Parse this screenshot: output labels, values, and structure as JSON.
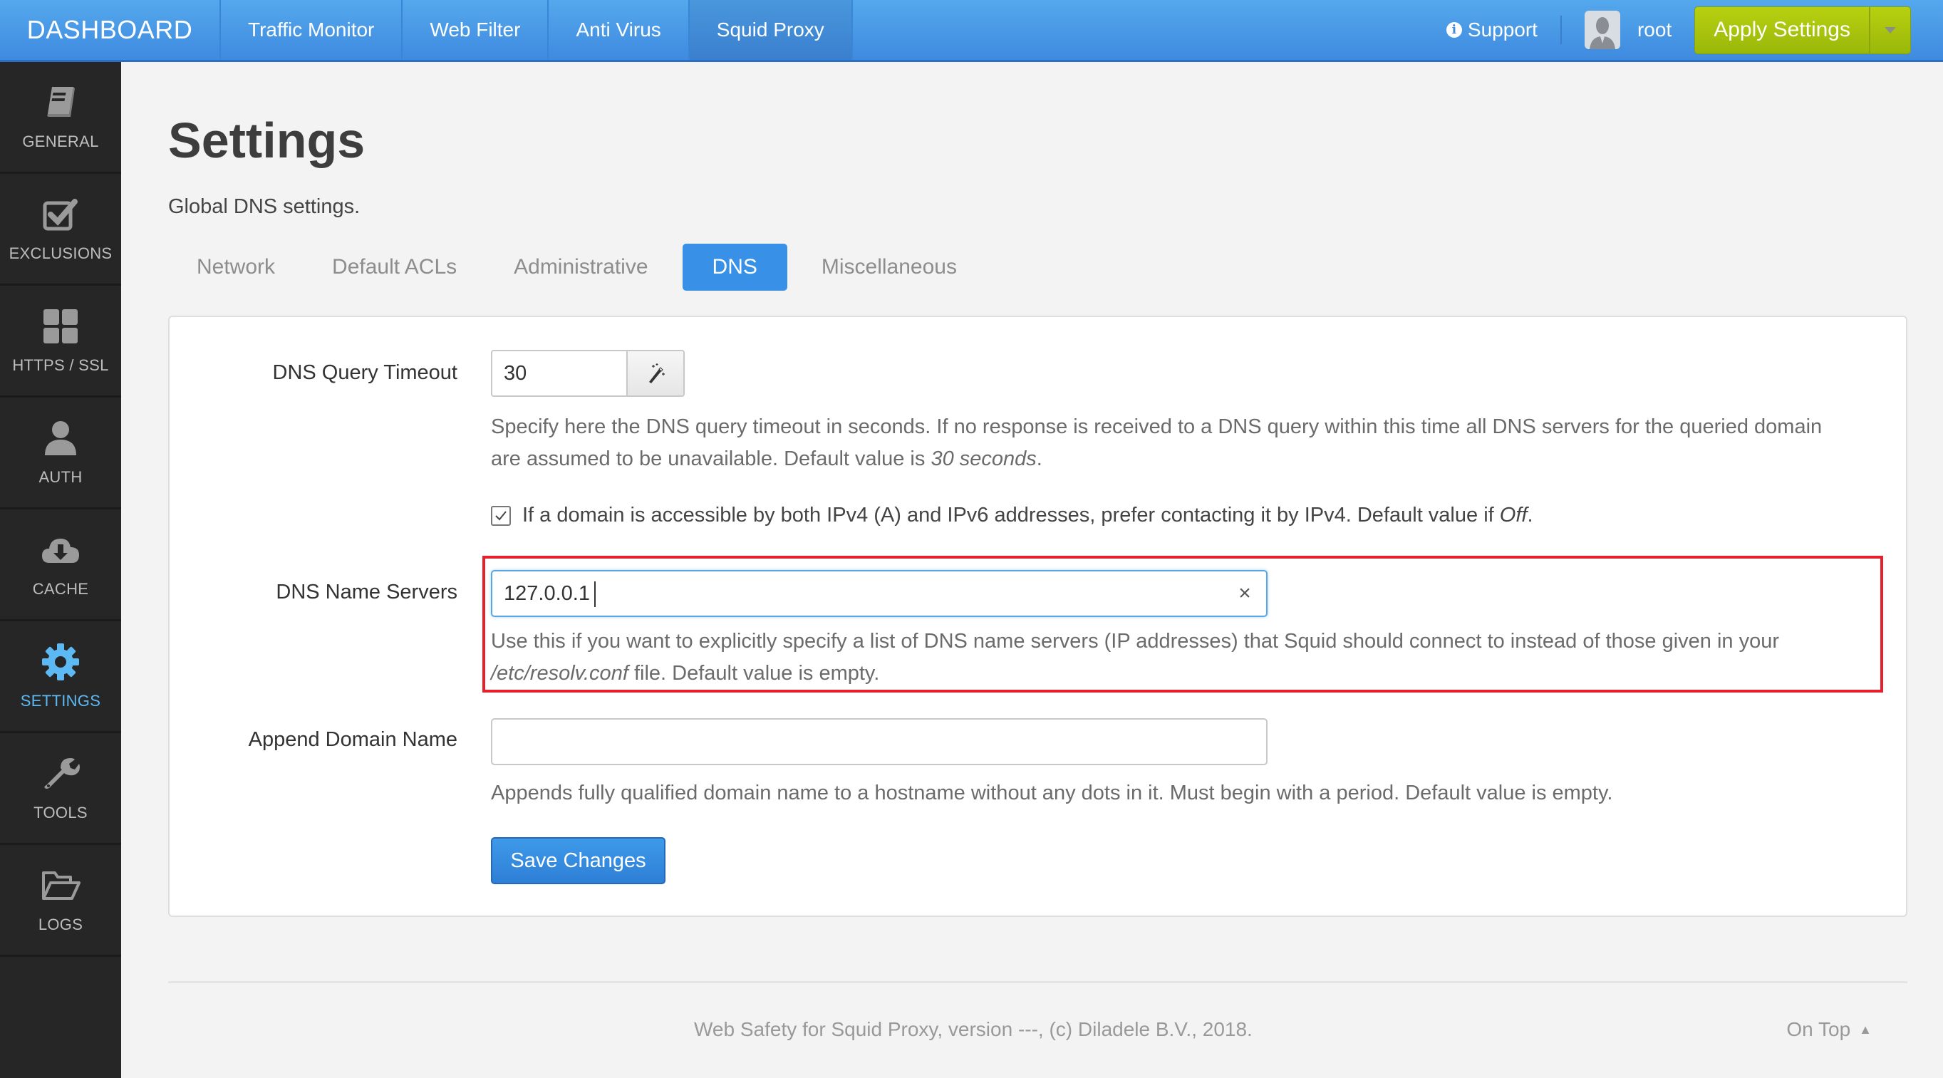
{
  "topbar": {
    "brand": "DASHBOARD",
    "nav": [
      {
        "label": "Traffic Monitor",
        "active": false
      },
      {
        "label": "Web Filter",
        "active": false
      },
      {
        "label": "Anti Virus",
        "active": false
      },
      {
        "label": "Squid Proxy",
        "active": true
      }
    ],
    "support_label": "Support",
    "user_name": "root",
    "apply_label": "Apply Settings",
    "accent_color": "#4a9ae6",
    "apply_color": "#a8c40c"
  },
  "sidebar": {
    "items": [
      {
        "label": "GENERAL",
        "icon": "book-icon",
        "active": false
      },
      {
        "label": "EXCLUSIONS",
        "icon": "checkbox-icon",
        "active": false
      },
      {
        "label": "HTTPS / SSL",
        "icon": "grid-icon",
        "active": false
      },
      {
        "label": "AUTH",
        "icon": "user-icon",
        "active": false
      },
      {
        "label": "CACHE",
        "icon": "cloud-download-icon",
        "active": false
      },
      {
        "label": "SETTINGS",
        "icon": "gear-icon",
        "active": true
      },
      {
        "label": "TOOLS",
        "icon": "wrench-icon",
        "active": false
      },
      {
        "label": "LOGS",
        "icon": "folder-open-icon",
        "active": false
      }
    ],
    "active_color": "#5db9f3"
  },
  "page": {
    "title": "Settings",
    "subtitle": "Global DNS settings.",
    "tabs": [
      {
        "label": "Network",
        "active": false
      },
      {
        "label": "Default ACLs",
        "active": false
      },
      {
        "label": "Administrative",
        "active": false
      },
      {
        "label": "DNS",
        "active": true
      },
      {
        "label": "Miscellaneous",
        "active": false
      }
    ]
  },
  "form": {
    "timeout": {
      "label": "DNS Query Timeout",
      "value": "30",
      "help_pre": "Specify here the DNS query timeout in seconds. If no response is received to a DNS query within this time all DNS servers for the queried domain are assumed to be unavailable. Default value is ",
      "help_em": "30 seconds",
      "help_post": "."
    },
    "prefer_ipv4": {
      "checked": true,
      "label_pre": "If a domain is accessible by both IPv4 (A) and IPv6 addresses, prefer contacting it by IPv4. Default value if ",
      "label_em": "Off",
      "label_post": "."
    },
    "name_servers": {
      "label": "DNS Name Servers",
      "value": "127.0.0.1",
      "help_pre": "Use this if you want to explicitly specify a list of DNS name servers (IP addresses) that Squid should connect to instead of those given in your ",
      "help_em": "/etc/resolv.conf",
      "help_post": " file. Default value is empty.",
      "highlight_color": "#e3202b"
    },
    "append_domain": {
      "label": "Append Domain Name",
      "value": "",
      "help": "Appends fully qualified domain name to a hostname without any dots in it. Must begin with a period. Default value is empty."
    },
    "save_label": "Save Changes"
  },
  "footer": {
    "text": "Web Safety for Squid Proxy, version ---, (c) Diladele B.V., 2018.",
    "on_top": "On Top"
  }
}
